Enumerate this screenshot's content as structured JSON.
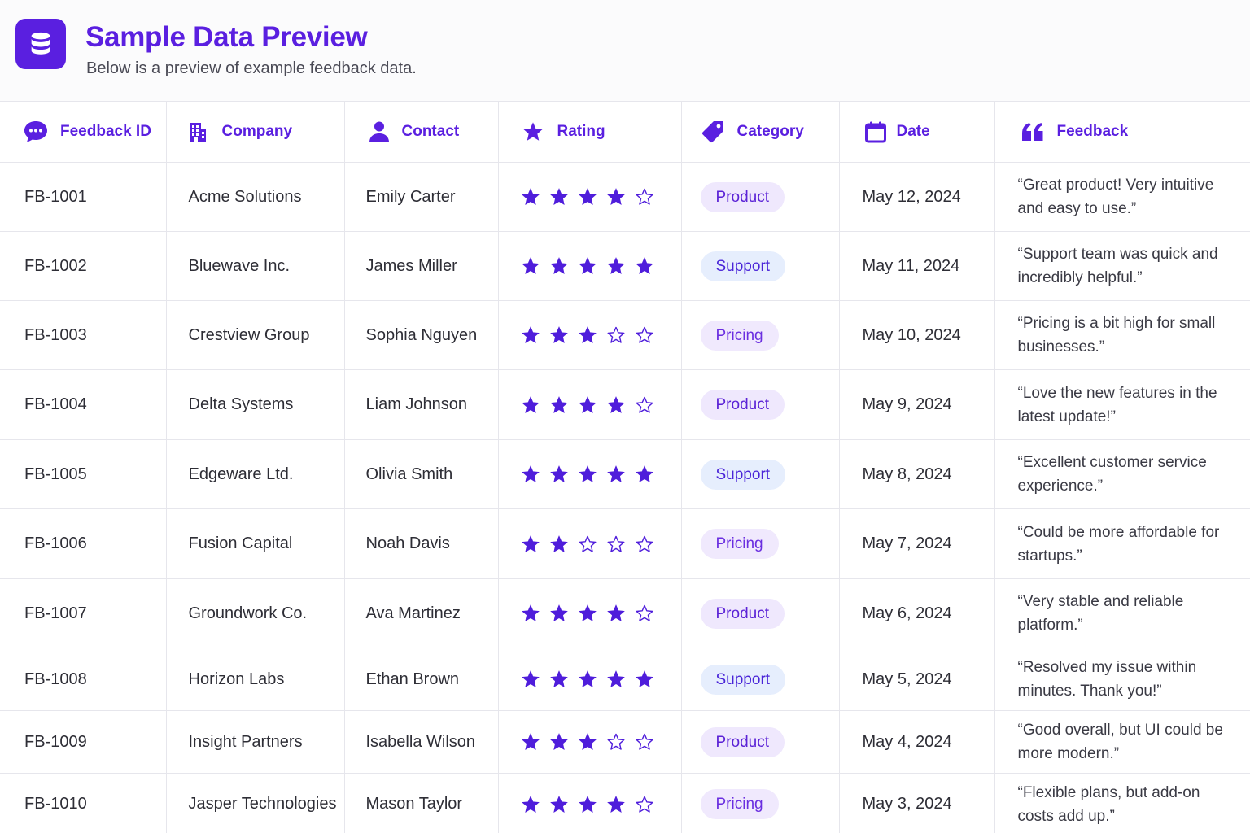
{
  "header": {
    "icon": "database-icon",
    "title": "Sample Data Preview",
    "subtitle": "Below is a preview of example feedback data."
  },
  "colors": {
    "accent": "#5a1fe0",
    "star": "#4f1ddb",
    "border": "#e6e6ec"
  },
  "table": {
    "columns": [
      {
        "label": "Feedback ID",
        "icon": "chat-bubble-icon"
      },
      {
        "label": "Company",
        "icon": "building-icon"
      },
      {
        "label": "Contact",
        "icon": "person-icon"
      },
      {
        "label": "Rating",
        "icon": "star-icon"
      },
      {
        "label": "Category",
        "icon": "tag-icon"
      },
      {
        "label": "Date",
        "icon": "calendar-icon"
      },
      {
        "label": "Feedback",
        "icon": "quote-icon"
      }
    ],
    "rows": [
      {
        "id": "FB-1001",
        "company": "Acme Solutions",
        "contact": "Emily Carter",
        "rating": 4,
        "category": "Product",
        "date": "May 12, 2024",
        "feedback": "“Great product! Very intuitive and easy to use.”"
      },
      {
        "id": "FB-1002",
        "company": "Bluewave Inc.",
        "contact": "James Miller",
        "rating": 5,
        "category": "Support",
        "date": "May 11, 2024",
        "feedback": "“Support team was quick and incredibly helpful.”"
      },
      {
        "id": "FB-1003",
        "company": "Crestview Group",
        "contact": "Sophia Nguyen",
        "rating": 3,
        "category": "Pricing",
        "date": "May 10, 2024",
        "feedback": "“Pricing is a bit high for small businesses.”"
      },
      {
        "id": "FB-1004",
        "company": "Delta Systems",
        "contact": "Liam Johnson",
        "rating": 4,
        "category": "Product",
        "date": "May 9, 2024",
        "feedback": "“Love the new features in the latest update!”"
      },
      {
        "id": "FB-1005",
        "company": "Edgeware Ltd.",
        "contact": "Olivia Smith",
        "rating": 5,
        "category": "Support",
        "date": "May 8, 2024",
        "feedback": "“Excellent customer service experience.”"
      },
      {
        "id": "FB-1006",
        "company": "Fusion Capital",
        "contact": "Noah Davis",
        "rating": 2,
        "category": "Pricing",
        "date": "May 7, 2024",
        "feedback": "“Could be more affordable for startups.”"
      },
      {
        "id": "FB-1007",
        "company": "Groundwork Co.",
        "contact": "Ava Martinez",
        "rating": 4,
        "category": "Product",
        "date": "May 6, 2024",
        "feedback": "“Very stable and reliable platform.”"
      },
      {
        "id": "FB-1008",
        "company": "Horizon Labs",
        "contact": "Ethan Brown",
        "rating": 5,
        "category": "Support",
        "date": "May 5, 2024",
        "feedback": "“Resolved my issue within minutes. Thank you!”"
      },
      {
        "id": "FB-1009",
        "company": "Insight Partners",
        "contact": "Isabella Wilson",
        "rating": 3,
        "category": "Product",
        "date": "May 4, 2024",
        "feedback": "“Good overall, but UI could be more modern.”"
      },
      {
        "id": "FB-1010",
        "company": "Jasper Technologies",
        "contact": "Mason Taylor",
        "rating": 4,
        "category": "Pricing",
        "date": "May 3, 2024",
        "feedback": "“Flexible plans, but add-on costs add up.”"
      }
    ]
  }
}
